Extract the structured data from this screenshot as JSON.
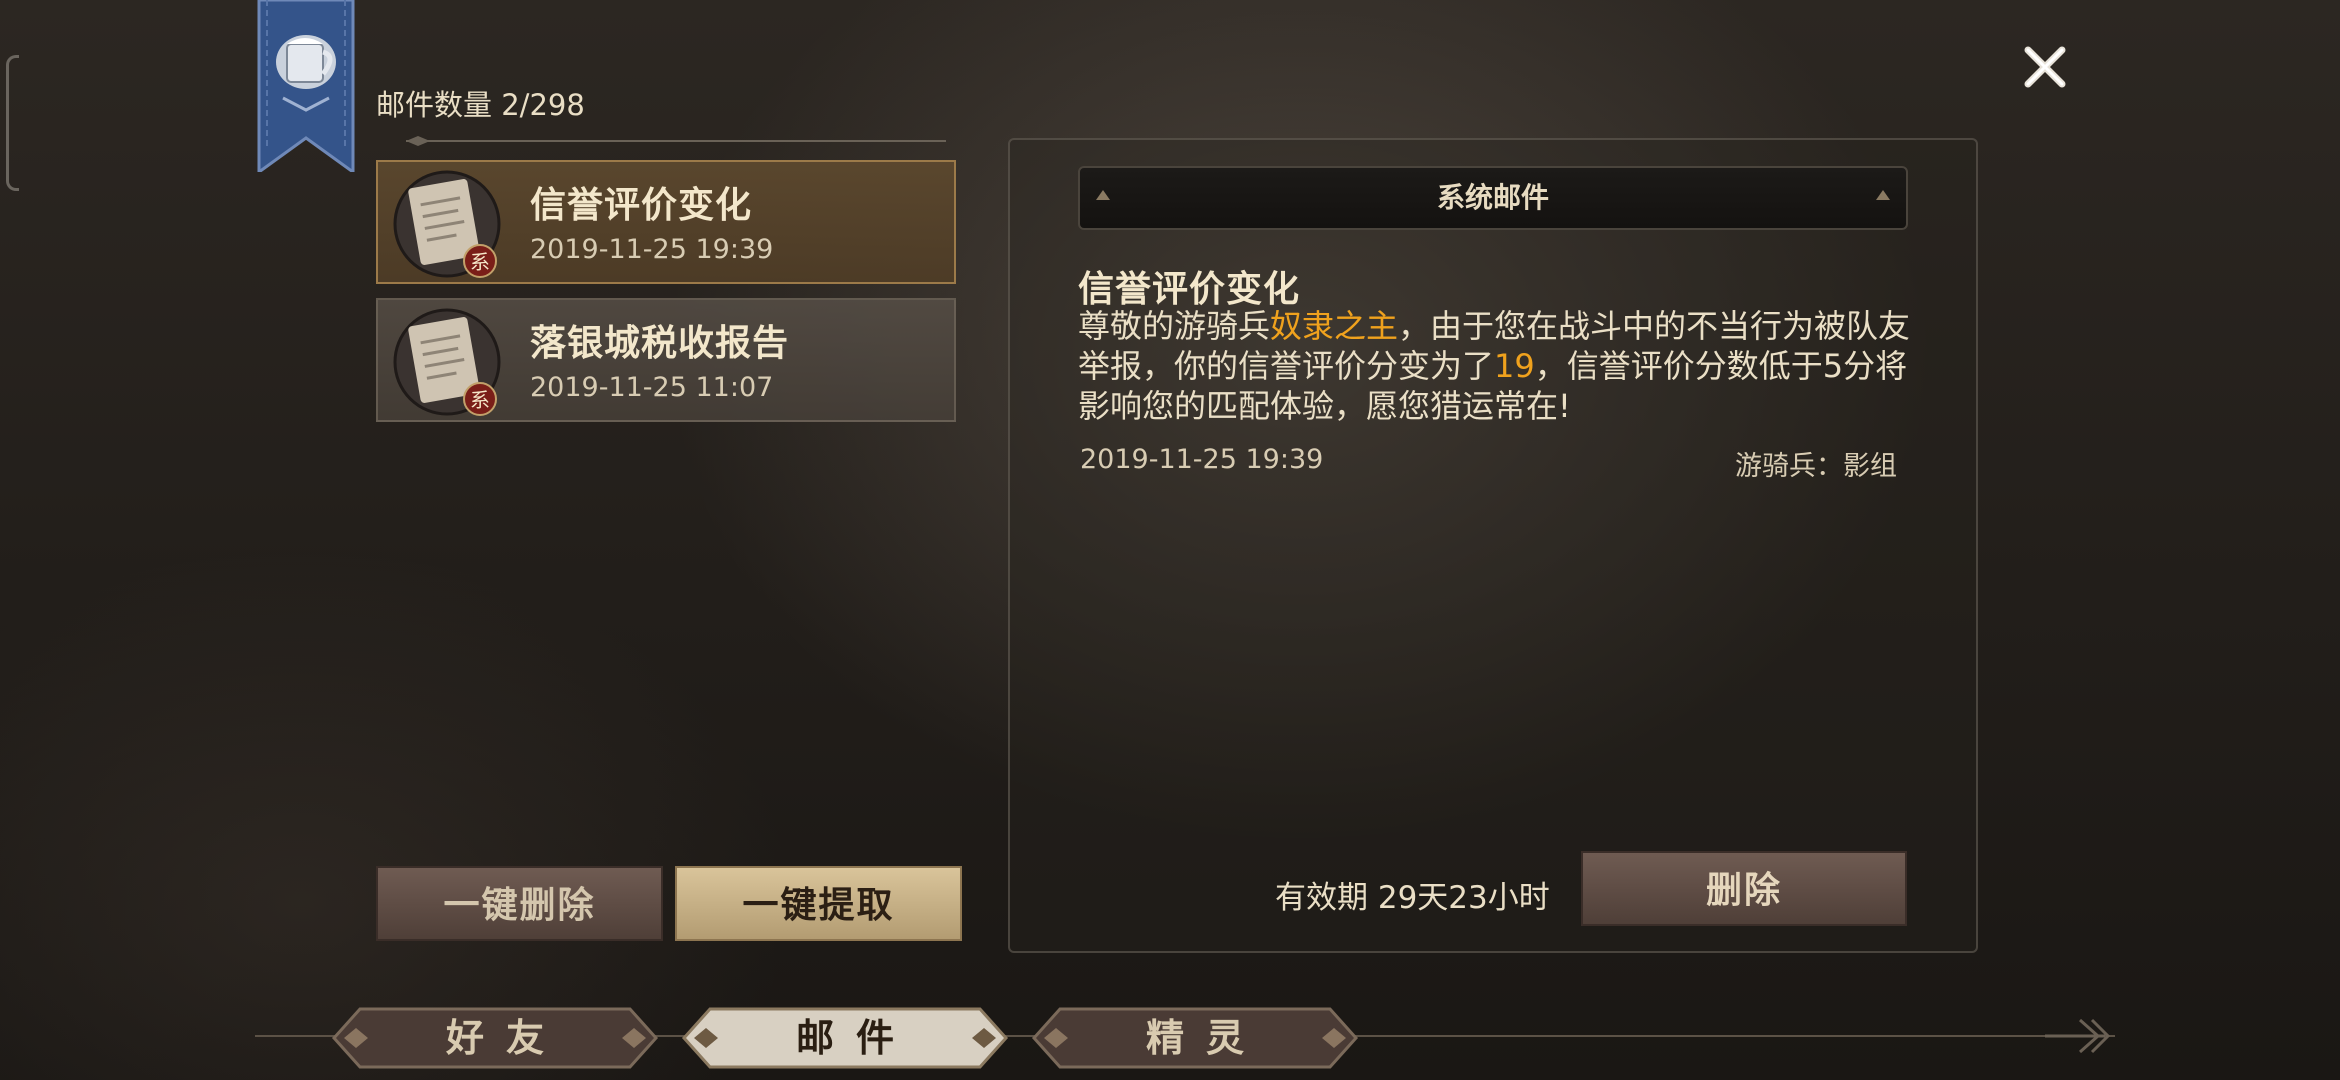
{
  "mail_list": {
    "count_label": "邮件数量 2/298",
    "items": [
      {
        "title": "信誉评价变化",
        "time": "2019-11-25 19:39",
        "badge": "系",
        "selected": true
      },
      {
        "title": "落银城税收报告",
        "time": "2019-11-25 11:07",
        "badge": "系",
        "selected": false
      }
    ],
    "delete_all_label": "一键删除",
    "claim_all_label": "一键提取"
  },
  "detail": {
    "header_label": "系统邮件",
    "subject": "信誉评价变化",
    "body": {
      "part1": "尊敬的游骑兵",
      "player_name": "奴隶之主",
      "part2": "，由于您在战斗中的不当行为被队友举报，你的信誉评价分变为了",
      "score": "19",
      "part3": "，信誉评价分数低于5分将影响您的匹配体验，愿您猎运常在!"
    },
    "time": "2019-11-25 19:39",
    "sender": "游骑兵：影组",
    "validity": "有效期 29天23小时",
    "delete_label": "删除"
  },
  "tabs": [
    {
      "label": "好友",
      "active": false
    },
    {
      "label": "邮件",
      "active": true
    },
    {
      "label": "精灵",
      "active": false
    }
  ],
  "colors": {
    "highlight": "#f0a21d",
    "banner_blue": "#3b5a8f",
    "selected_border": "#9c7a49"
  },
  "icons": {
    "banner": "mug-banner-icon",
    "close": "close-icon",
    "mail_item": "scroll-icon",
    "badge": "system-badge-icon"
  }
}
